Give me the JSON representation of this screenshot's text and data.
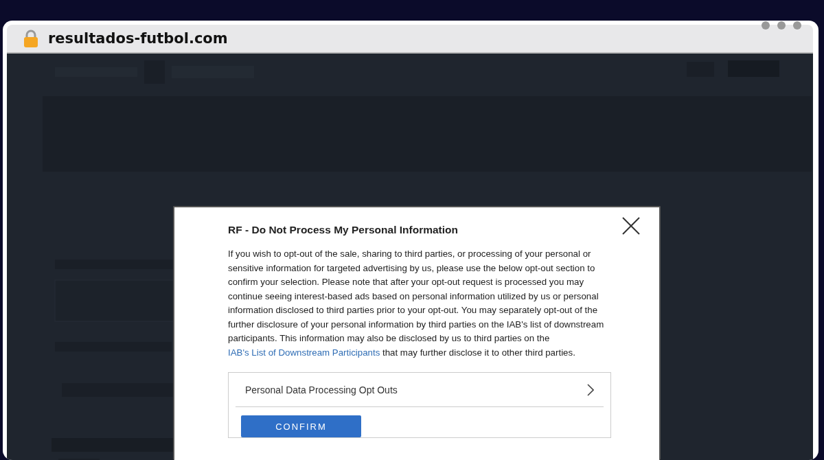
{
  "browser": {
    "url": "resultados-futbol.com"
  },
  "dialog": {
    "title": "RF - Do Not Process My Personal Information",
    "body": "If you wish to opt-out of the sale, sharing to third parties, or processing of your personal or sensitive information for targeted advertising by us, please use the below opt-out section to confirm your selection. Please note that after your opt-out request is processed you may continue seeing interest-based ads based on personal information utilized by us or personal information disclosed to third parties prior to your opt-out. You may separately opt-out of the further disclosure of your personal information by third parties on the IAB's list of downstream participants. This information may also be disclosed by us to third parties on the ",
    "link": "IAB's List of Downstream Participants",
    "body_end": " that may further disclose it to other third parties.",
    "options": [
      {
        "label": "Personal Data Processing Opt Outs"
      }
    ],
    "confirm_button": "CONFIRM"
  }
}
